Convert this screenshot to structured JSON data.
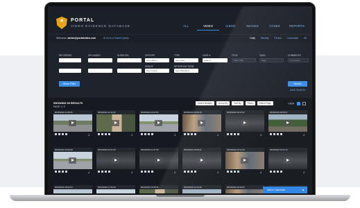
{
  "app": {
    "title": "PORTAL",
    "subtitle": "VIDEO EVIDENCE DATABASE",
    "nav_tabs": [
      {
        "label": "ALL",
        "active": false
      },
      {
        "label": "VIDEO",
        "active": true
      },
      {
        "label": "AUDIO",
        "active": false
      },
      {
        "label": "IMAGES",
        "active": false
      },
      {
        "label": "CASES",
        "active": false
      },
      {
        "label": "REPORTS",
        "active": false
      }
    ]
  },
  "userbar": {
    "welcome_prefix": "Welcome,",
    "user_email": "admin@portalvideo.com",
    "quick_link": "⊕ Go to a Saved Query",
    "ranges": [
      {
        "label": "Daily",
        "active": true
      },
      {
        "label": "Weekly",
        "active": false
      },
      {
        "label": "Period",
        "active": false
      },
      {
        "label": "Customize",
        "active": false
      },
      {
        "label": "All",
        "active": false
      }
    ]
  },
  "filters": {
    "labels": {
      "recorded": "RECORDED",
      "uploaded": "UPLOADED",
      "duration": "DURATION",
      "officer": "OFFICER",
      "type": "TYPE",
      "case": "CASE #",
      "title": "TITLE",
      "tags": "TAGS",
      "comments": "COMMENTS",
      "group": "GROUP",
      "retention": "RETENTION TERM"
    },
    "officer_value": "(any officer)",
    "type_value": "(any type)",
    "case_value": "Case #",
    "title_placeholder": "Video Title",
    "tags_placeholder": "Tags",
    "comments_placeholder": "Comments",
    "group_value": "(any Group)",
    "retention_value": "(any Retention)",
    "show_filter_label": "Show Filter",
    "search_label": "Search",
    "save_search_label": "SAVE SEARCH"
  },
  "results": {
    "title": "SHOWING 66 RESULTS",
    "page": "PAGE 1 / 3",
    "tools": [
      "Select Multiple",
      "Group By",
      "Sort By",
      "Show",
      "Select Page"
    ],
    "view_label": "VIEW"
  },
  "cards": [
    {
      "date": "06/05/2022 12:08:35",
      "scene": "suburb"
    },
    {
      "date": "06/05/2022 11:34:20",
      "scene": "man"
    },
    {
      "date": "06/05/2022 10:02:51",
      "scene": "street"
    },
    {
      "date": "06/05/2022 09:48:16",
      "scene": "crowd"
    },
    {
      "date": "06/05/2022 09:12:31",
      "scene": "dark"
    },
    {
      "date": "06/05/2022 08:55:07",
      "scene": "trees"
    },
    {
      "date": "06/04/2022 23:08:18",
      "scene": "street"
    },
    {
      "date": "06/04/2022 22:41:39",
      "scene": "dark"
    },
    {
      "date": "06/04/2022 21:37:56",
      "scene": "dark"
    },
    {
      "date": "06/04/2022 20:55:21",
      "scene": "dark"
    },
    {
      "date": "06/04/2022 20:12:10",
      "scene": "crowd"
    },
    {
      "date": "06/04/2022 19:47:13",
      "scene": "dark"
    },
    {
      "date": "06/04/2022 18:22:04",
      "scene": "suburb"
    },
    {
      "date": "06/04/2022 17:36:29",
      "scene": "street"
    },
    {
      "date": "06/04/2022 16:58:11",
      "scene": "man"
    },
    {
      "date": "06/04/2022 16:13:48",
      "scene": "trees"
    },
    {
      "date": "06/04/2022 15:40:02",
      "scene": "crowd"
    },
    {
      "date": "06/04/2022 15:02:57",
      "scene": "street"
    }
  ],
  "add_case_label": "Add a Caseload",
  "colors": {
    "accent": "#3a8ee6",
    "brand_gold": "#e8a417",
    "background": "#16191f"
  }
}
